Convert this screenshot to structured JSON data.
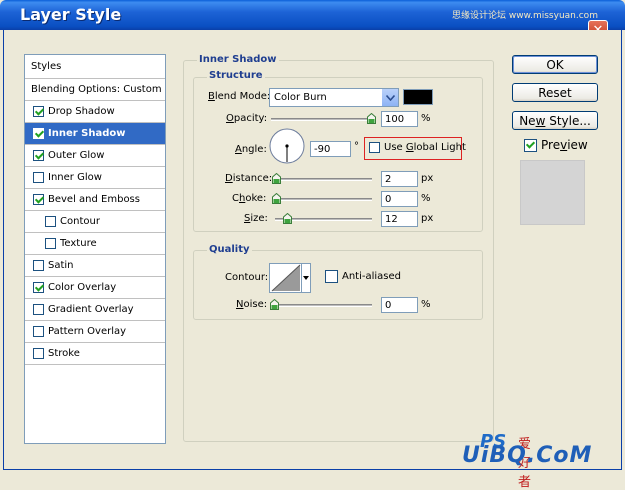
{
  "window": {
    "title": "Layer Style",
    "watermark_top": "思缘设计论坛 www.missyuan.com",
    "close_glyph": "✕"
  },
  "styles_list": {
    "header": "Styles",
    "blending_options": "Blending Options: Custom",
    "items": [
      {
        "label": "Drop Shadow",
        "checked": true,
        "selected": false,
        "sub": false
      },
      {
        "label": "Inner Shadow",
        "checked": true,
        "selected": true,
        "sub": false
      },
      {
        "label": "Outer Glow",
        "checked": true,
        "selected": false,
        "sub": false
      },
      {
        "label": "Inner Glow",
        "checked": false,
        "selected": false,
        "sub": false
      },
      {
        "label": "Bevel and Emboss",
        "checked": true,
        "selected": false,
        "sub": false
      },
      {
        "label": "Contour",
        "checked": false,
        "selected": false,
        "sub": true
      },
      {
        "label": "Texture",
        "checked": false,
        "selected": false,
        "sub": true
      },
      {
        "label": "Satin",
        "checked": false,
        "selected": false,
        "sub": false
      },
      {
        "label": "Color Overlay",
        "checked": true,
        "selected": false,
        "sub": false
      },
      {
        "label": "Gradient Overlay",
        "checked": false,
        "selected": false,
        "sub": false
      },
      {
        "label": "Pattern Overlay",
        "checked": false,
        "selected": false,
        "sub": false
      },
      {
        "label": "Stroke",
        "checked": false,
        "selected": false,
        "sub": false
      }
    ]
  },
  "inner_shadow": {
    "title": "Inner Shadow",
    "structure_title": "Structure",
    "blend_mode_label": "Blend Mode:",
    "blend_mode_value": "Color Burn",
    "shadow_color": "#000000",
    "opacity_label": "Opacity:",
    "opacity_value": "100",
    "opacity_unit": "%",
    "angle_label": "Angle:",
    "angle_value": "-90",
    "angle_unit": "°",
    "use_global_light_label": "Use Global Light",
    "use_global_light_checked": false,
    "distance_label": "Distance:",
    "distance_value": "2",
    "distance_unit": "px",
    "choke_label": "Choke:",
    "choke_value": "0",
    "choke_unit": "%",
    "size_label": "Size:",
    "size_value": "12",
    "size_unit": "px"
  },
  "quality": {
    "title": "Quality",
    "contour_label": "Contour:",
    "anti_aliased_label": "Anti-aliased",
    "anti_aliased_checked": false,
    "noise_label": "Noise:",
    "noise_value": "0",
    "noise_unit": "%"
  },
  "buttons": {
    "ok": "OK",
    "reset": "Reset",
    "new_style": "New Style...",
    "preview_label": "Preview",
    "preview_checked": true
  },
  "watermark_bottom": {
    "ps": "PS",
    "cn": "爱好者",
    "ui": "UiBQ.CoM",
    "com": ""
  },
  "colors": {
    "titlebar": "#0a4fc2",
    "selected_row": "#316ac5",
    "group_title": "#1f3e90",
    "highlight": "#dd2222"
  }
}
